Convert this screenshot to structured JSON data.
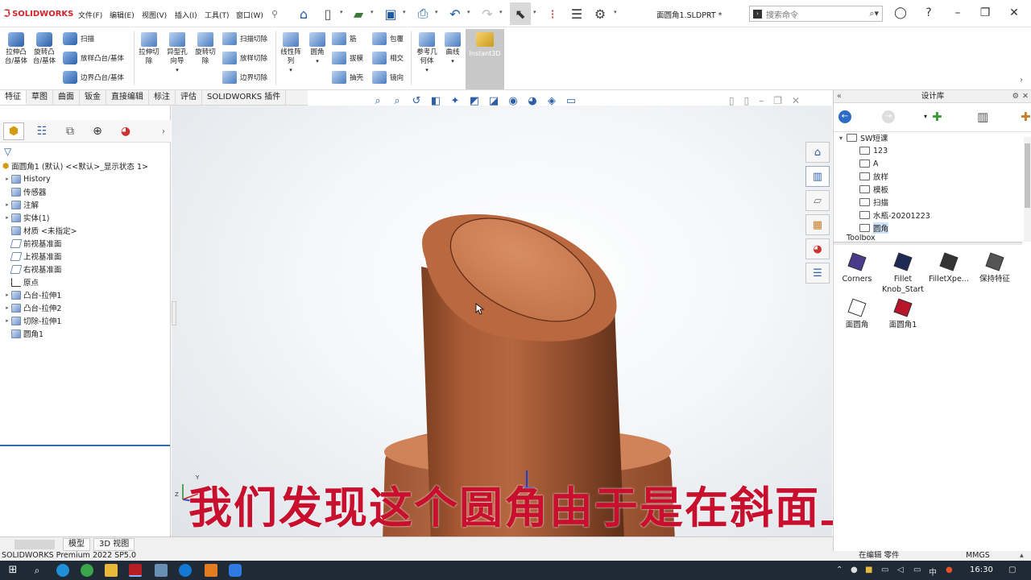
{
  "titlebar": {
    "brand": "SOLIDWORKS",
    "menus": [
      "文件(F)",
      "编辑(E)",
      "视图(V)",
      "插入(I)",
      "工具(T)",
      "窗口(W)"
    ],
    "document_title": "面圆角1.SLDPRT *",
    "search_placeholder": "搜索命令",
    "icons": [
      "pin-icon",
      "home-icon",
      "new-icon",
      "open-icon",
      "save-icon",
      "print-icon",
      "undo-icon",
      "redo-icon",
      "select-icon",
      "traffic-light-icon",
      "file-properties-icon",
      "options-gear-icon",
      "user-icon",
      "help-icon",
      "minimize-icon",
      "restore-icon",
      "close-icon"
    ]
  },
  "ribbon": {
    "boss_extrude": "拉伸凸台/基体",
    "revolve_boss": "旋转凸台/基体",
    "sweep": "扫描",
    "loft_boss": "放样凸台/基体",
    "boundary_boss": "边界凸台/基体",
    "extruded_cut": "拉伸切除",
    "hole_wizard": "异型孔向导",
    "revolved_cut": "旋转切除",
    "swept_cut": "扫描切除",
    "lofted_cut": "放样切除",
    "boundary_cut": "边界切除",
    "linear_pattern": "线性阵列",
    "fillet": "圆角",
    "rib": "筋",
    "draft": "拔模",
    "shell": "抽壳",
    "wrap": "包覆",
    "intersect": "相交",
    "mirror": "镜向",
    "ref_geometry": "参考几何体",
    "curves": "曲线",
    "instant3d": "Instant3D"
  },
  "command_tabs": [
    "特征",
    "草图",
    "曲面",
    "钣金",
    "直接编辑",
    "标注",
    "评估",
    "SOLIDWORKS 插件"
  ],
  "feature_tree": {
    "root": "面圆角1 (默认) <<默认>_显示状态 1>",
    "items": [
      {
        "label": "History",
        "expand": "▸"
      },
      {
        "label": "传感器",
        "expand": ""
      },
      {
        "label": "注解",
        "expand": "▸"
      },
      {
        "label": "实体(1)",
        "expand": "▸"
      },
      {
        "label": "材质 <未指定>",
        "expand": ""
      },
      {
        "label": "前视基准面",
        "expand": ""
      },
      {
        "label": "上视基准面",
        "expand": ""
      },
      {
        "label": "右视基准面",
        "expand": ""
      },
      {
        "label": "原点",
        "expand": ""
      },
      {
        "label": "凸台-拉伸1",
        "expand": "▸"
      },
      {
        "label": "凸台-拉伸2",
        "expand": "▸"
      },
      {
        "label": "切除-拉伸1",
        "expand": "▸"
      },
      {
        "label": "圆角1",
        "expand": ""
      }
    ]
  },
  "viewport": {
    "subtitle": "我们发现这个圆角由于是在斜面上",
    "triad_y": "Y",
    "triad_z": "Z",
    "part_color": "#b86a44"
  },
  "design_library": {
    "title": "设计库",
    "root": "SW短课",
    "folders": [
      "123",
      "A",
      "放样",
      "模板",
      "扫描",
      "水瓶-20201223",
      "圆角"
    ],
    "selected_folder": "圆角",
    "next": "Toolbox",
    "items": [
      "Corners",
      "Fillet Knob_Start",
      "FilletXpe...",
      "保持特征",
      "面圆角",
      "面圆角1"
    ]
  },
  "sheet_tabs": [
    "模型",
    "3D 视图"
  ],
  "status": {
    "product": "SOLIDWORKS Premium 2022 SP5.0",
    "editing": "在编辑 零件",
    "units": "MMGS"
  },
  "taskbar": {
    "time": "16:30",
    "ime": "中"
  }
}
